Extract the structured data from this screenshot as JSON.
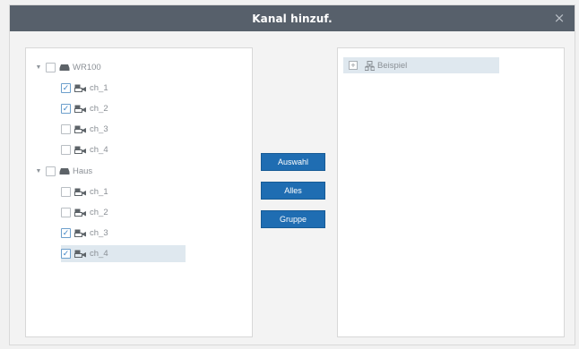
{
  "dialog": {
    "title": "Kanal hinzuf.",
    "close_glyph": "×"
  },
  "tree": {
    "groups": [
      {
        "label": "WR100",
        "expanded": true,
        "checked": false,
        "icon": "device-icon",
        "channels": [
          {
            "label": "ch_1",
            "checked": true,
            "icon": "camera-icon"
          },
          {
            "label": "ch_2",
            "checked": true,
            "icon": "camera-icon"
          },
          {
            "label": "ch_3",
            "checked": false,
            "icon": "camera-icon"
          },
          {
            "label": "ch_4",
            "checked": false,
            "icon": "camera-icon"
          }
        ]
      },
      {
        "label": "Haus",
        "expanded": true,
        "checked": false,
        "icon": "device-icon",
        "channels": [
          {
            "label": "ch_1",
            "checked": false,
            "icon": "camera-icon"
          },
          {
            "label": "ch_2",
            "checked": false,
            "icon": "camera-icon"
          },
          {
            "label": "ch_3",
            "checked": true,
            "icon": "camera-icon"
          },
          {
            "label": "ch_4",
            "checked": true,
            "icon": "camera-icon",
            "selected": true
          }
        ]
      }
    ]
  },
  "buttons": {
    "selection_label": "Auswahl",
    "all_label": "Alles",
    "group_label": "Gruppe"
  },
  "right": {
    "group": {
      "label": "Beispiel",
      "icon": "group-icon",
      "expand_glyph": "+"
    }
  },
  "colors": {
    "titlebar": "#57606b",
    "button": "#1f6db2",
    "selection": "#dfe8ef"
  }
}
